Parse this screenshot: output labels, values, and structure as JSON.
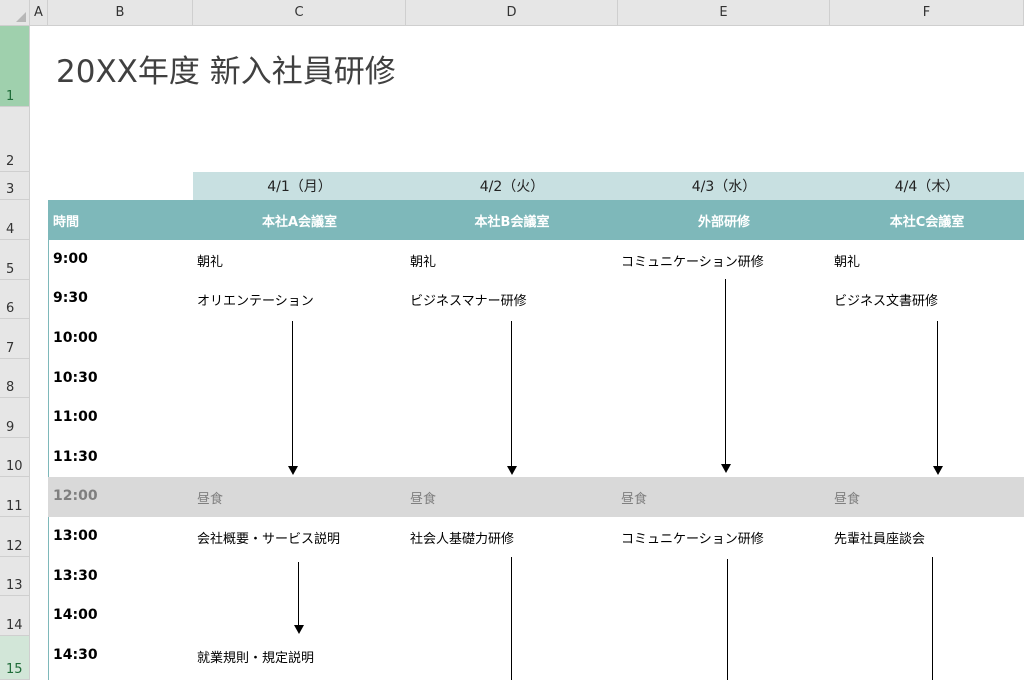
{
  "columns": [
    "A",
    "B",
    "C",
    "D",
    "E",
    "F"
  ],
  "rows": [
    "1",
    "2",
    "3",
    "4",
    "5",
    "6",
    "7",
    "8",
    "9",
    "10",
    "11",
    "12",
    "13",
    "14",
    "15"
  ],
  "title": "20XX年度 新入社員研修",
  "dates": [
    "4/1（月）",
    "4/2（火）",
    "4/3（水）",
    "4/4（木）"
  ],
  "header": {
    "time_label": "時間",
    "rooms": [
      "本社A会議室",
      "本社B会議室",
      "外部研修",
      "本社C会議室"
    ]
  },
  "times": [
    "9:00",
    "9:30",
    "10:00",
    "10:30",
    "11:00",
    "11:30",
    "12:00",
    "13:00",
    "13:30",
    "14:00",
    "14:30"
  ],
  "schedule": {
    "day1": {
      "r0900": "朝礼",
      "r0930": "オリエンテーション",
      "r1200": "昼食",
      "r1300": "会社概要・サービス説明",
      "r1430": "就業規則・規定説明"
    },
    "day2": {
      "r0900": "朝礼",
      "r0930": "ビジネスマナー研修",
      "r1200": "昼食",
      "r1300": "社会人基礎力研修"
    },
    "day3": {
      "r0900": "コミュニケーション研修",
      "r1200": "昼食",
      "r1300": "コミュニケーション研修"
    },
    "day4": {
      "r0900": "朝礼",
      "r0930": "ビジネス文書研修",
      "r1200": "昼食",
      "r1300": "先輩社員座談会"
    }
  },
  "colors": {
    "header_fill": "#7eb8ba",
    "date_fill": "#c8e0e1",
    "lunch_fill": "#d9d9d9",
    "selected_row_header": "#9fd0ad"
  }
}
